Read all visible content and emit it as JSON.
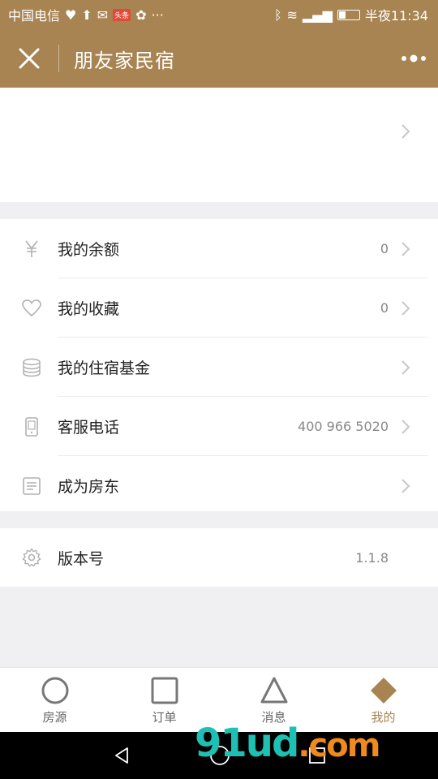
{
  "status_bar": {
    "carrier": "中国电信",
    "badge": "头条",
    "time_label": "半夜11:34"
  },
  "header": {
    "title": "朋友家民宿"
  },
  "menu_group_1": [
    {
      "label": "我的余额",
      "value": "0",
      "icon": "yen-icon"
    },
    {
      "label": "我的收藏",
      "value": "0",
      "icon": "heart-icon"
    },
    {
      "label": "我的住宿基金",
      "value": "",
      "icon": "coins-stack-icon"
    },
    {
      "label": "客服电话",
      "value": "400 966 5020",
      "icon": "phone-icon"
    },
    {
      "label": "成为房东",
      "value": "",
      "icon": "document-icon"
    }
  ],
  "menu_group_2": [
    {
      "label": "版本号",
      "value": "1.1.8",
      "icon": "gear-icon"
    }
  ],
  "tabs": [
    {
      "label": "房源",
      "icon": "circle-icon"
    },
    {
      "label": "订单",
      "icon": "square-icon"
    },
    {
      "label": "消息",
      "icon": "triangle-icon"
    },
    {
      "label": "我的",
      "icon": "diamond-icon",
      "active": true
    }
  ],
  "watermark": {
    "main": "91ud",
    "suffix": ".com"
  },
  "colors": {
    "brand": "#a88452",
    "text": "#222222",
    "muted": "#888888"
  }
}
